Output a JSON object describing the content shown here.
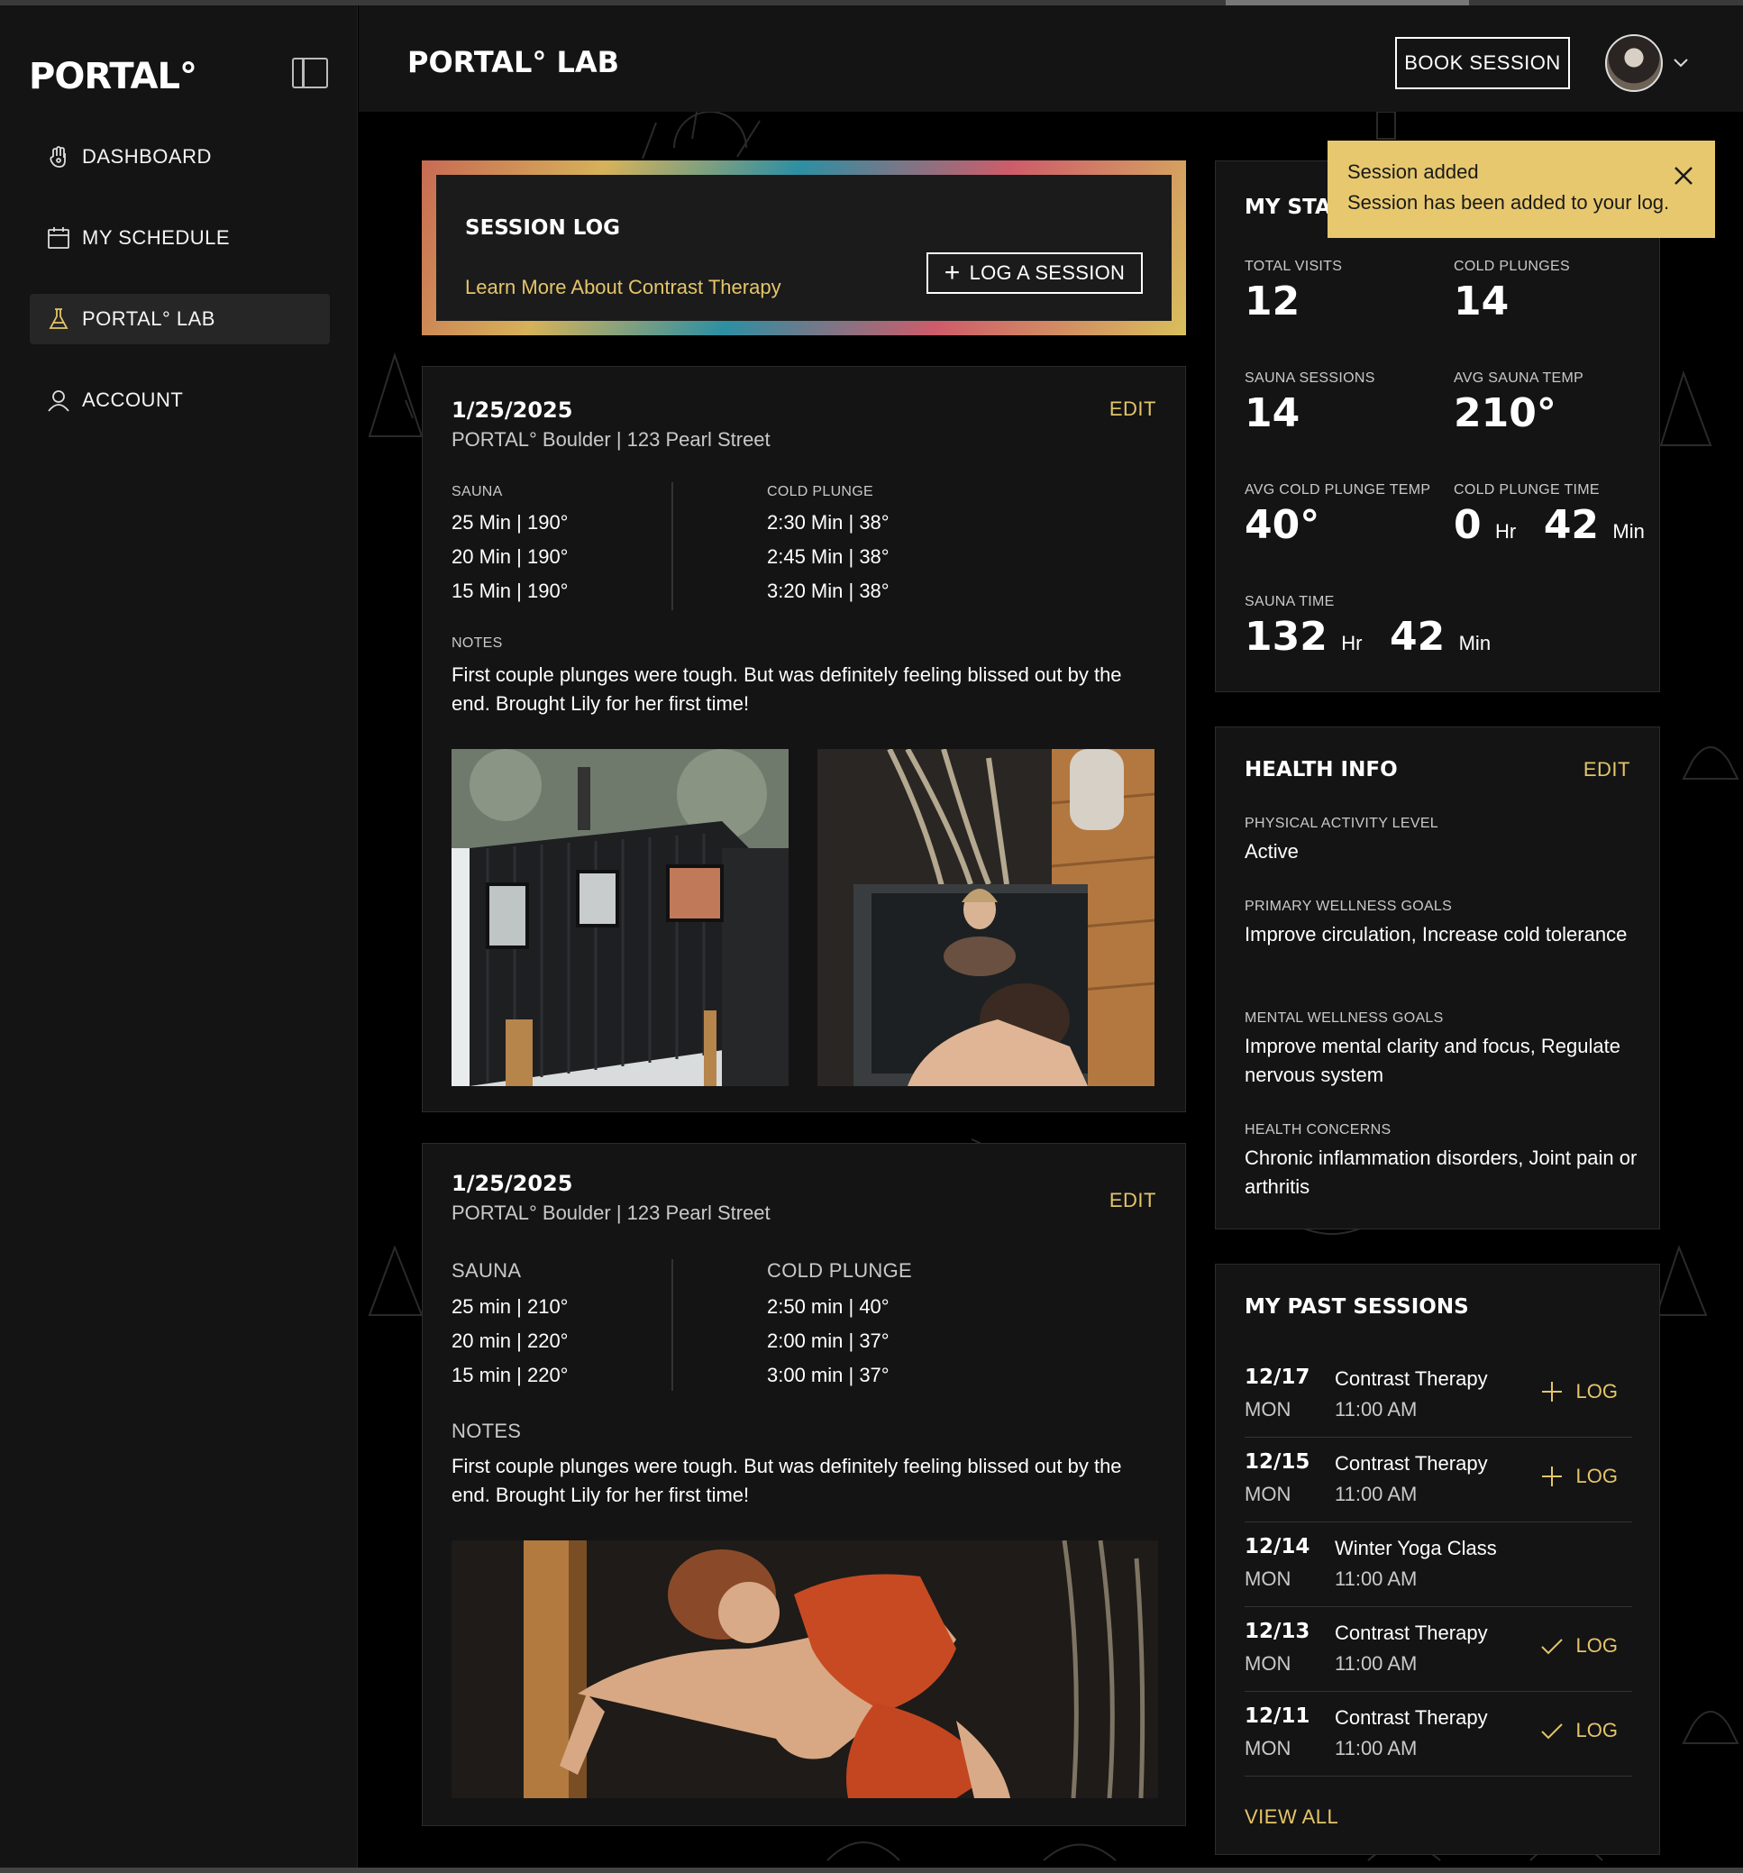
{
  "brand": {
    "logo": "PORTAL°"
  },
  "sidebar": {
    "items": [
      {
        "label": "DASHBOARD",
        "icon": "hand-icon"
      },
      {
        "label": "MY SCHEDULE",
        "icon": "calendar-icon"
      },
      {
        "label": "PORTAL° LAB",
        "icon": "flask-icon",
        "active": true
      },
      {
        "label": "ACCOUNT",
        "icon": "user-icon"
      }
    ]
  },
  "header": {
    "title": "PORTAL° LAB",
    "book_label": "BOOK SESSION"
  },
  "banner": {
    "title": "SESSION LOG",
    "link": "Learn More About Contrast Therapy",
    "log_label": "LOG A SESSION"
  },
  "entries": [
    {
      "date": "1/25/2025",
      "location": "PORTAL° Boulder | 123 Pearl Street",
      "edit": "EDIT",
      "sauna_head": "SAUNA",
      "plunge_head": "COLD PLUNGE",
      "sauna": [
        "25 Min | 190°",
        "20 Min | 190°",
        "15 Min | 190°"
      ],
      "plunge": [
        "2:30 Min | 38°",
        "2:45 Min | 38°",
        "3:20 Min | 38°"
      ],
      "notes_head": "NOTES",
      "notes": "First couple plunges were tough. But was definitely feeling blissed out by the end. Brought Lily for her first time!"
    },
    {
      "date": "1/25/2025",
      "location": "PORTAL° Boulder | 123 Pearl Street",
      "edit": "EDIT",
      "sauna_head": "SAUNA",
      "plunge_head": "COLD PLUNGE",
      "sauna": [
        "25 min | 210°",
        "20 min | 220°",
        "15 min | 220°"
      ],
      "plunge": [
        "2:50 min | 40°",
        "2:00 min | 37°",
        "3:00 min | 37°"
      ],
      "notes_head": "NOTES",
      "notes": "First couple plunges were tough. But was definitely feeling blissed out by the end. Brought Lily for her first time!"
    }
  ],
  "toast": {
    "title": "Session added",
    "message": "Session has been added to your log."
  },
  "stats": {
    "title": "MY STA",
    "total_visits_label": "TOTAL VISITS",
    "total_visits": "12",
    "cold_plunges_label": "COLD PLUNGES",
    "cold_plunges": "14",
    "sauna_sessions_label": "SAUNA SESSIONS",
    "sauna_sessions": "14",
    "avg_sauna_temp_label": "AVG SAUNA TEMP",
    "avg_sauna_temp": "210°",
    "avg_plunge_temp_label": "AVG COLD PLUNGE TEMP",
    "avg_plunge_temp": "40°",
    "plunge_time_label": "COLD PLUNGE TIME",
    "plunge_time_hr": "0",
    "plunge_time_min": "42",
    "sauna_time_label": "SAUNA TIME",
    "sauna_time_hr": "132",
    "sauna_time_min": "42",
    "hr_unit": "Hr",
    "min_unit": "Min"
  },
  "health": {
    "title": "HEALTH INFO",
    "edit": "EDIT",
    "activity_label": "PHYSICAL ACTIVITY LEVEL",
    "activity": "Active",
    "primary_label": "PRIMARY WELLNESS GOALS",
    "primary": "Improve circulation, Increase cold tolerance",
    "mental_label": "MENTAL WELLNESS GOALS",
    "mental": "Improve mental clarity and focus, Regulate nervous system",
    "concerns_label": "HEALTH CONCERNS",
    "concerns": "Chronic inflammation disorders, Joint pain or arthritis"
  },
  "past": {
    "title": "MY PAST SESSIONS",
    "view_all": "VIEW ALL",
    "log_label": "LOG",
    "rows": [
      {
        "date": "12/17",
        "day": "MON",
        "name": "Contrast Therapy",
        "time": "11:00 AM",
        "action": "add"
      },
      {
        "date": "12/15",
        "day": "MON",
        "name": "Contrast Therapy",
        "time": "11:00 AM",
        "action": "add"
      },
      {
        "date": "12/14",
        "day": "MON",
        "name": "Winter Yoga Class",
        "time": "11:00 AM",
        "action": "none"
      },
      {
        "date": "12/13",
        "day": "MON",
        "name": "Contrast Therapy",
        "time": "11:00 AM",
        "action": "done"
      },
      {
        "date": "12/11",
        "day": "MON",
        "name": "Contrast Therapy",
        "time": "11:00 AM",
        "action": "done"
      }
    ]
  },
  "colors": {
    "accent": "#e4c56a",
    "toast": "#e7c86e",
    "panel": "#141414"
  }
}
